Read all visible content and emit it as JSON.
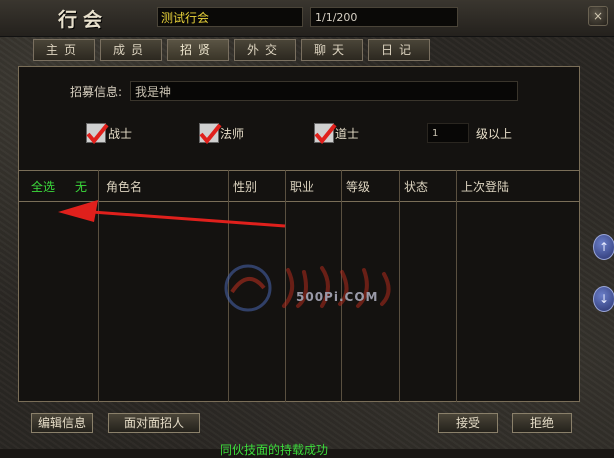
{
  "window": {
    "title": "行会",
    "guild_name": "测试行会",
    "member_count": "1/1/200",
    "close": "×"
  },
  "tabs": [
    {
      "label": "主页"
    },
    {
      "label": "成员"
    },
    {
      "label": "招贤",
      "active": true
    },
    {
      "label": "外交"
    },
    {
      "label": "聊天"
    },
    {
      "label": "日记"
    }
  ],
  "recruit": {
    "label": "招募信息:",
    "message": "我是神"
  },
  "classes": [
    {
      "label": "战士",
      "checked": true
    },
    {
      "label": "法师",
      "checked": true
    },
    {
      "label": "道士",
      "checked": true
    }
  ],
  "level": {
    "value": "1",
    "suffix": "级以上"
  },
  "table": {
    "select_all": "全选",
    "none": "无",
    "columns": [
      "角色名",
      "性别",
      "职业",
      "等级",
      "状态",
      "上次登陆"
    ]
  },
  "watermark": {
    "text": "500Pi.COM"
  },
  "buttons": {
    "edit_info": "编辑信息",
    "face_recruit": "面对面招人",
    "accept": "接受",
    "reject": "拒绝"
  },
  "scroll": {
    "up": "↑",
    "down": "↓"
  },
  "status_line": "同伙技面的持载成功",
  "colors": {
    "highlight_green": "#3cdc3c",
    "guild_name_yellow": "#e8d23a",
    "arrow_red": "#e0201c"
  }
}
